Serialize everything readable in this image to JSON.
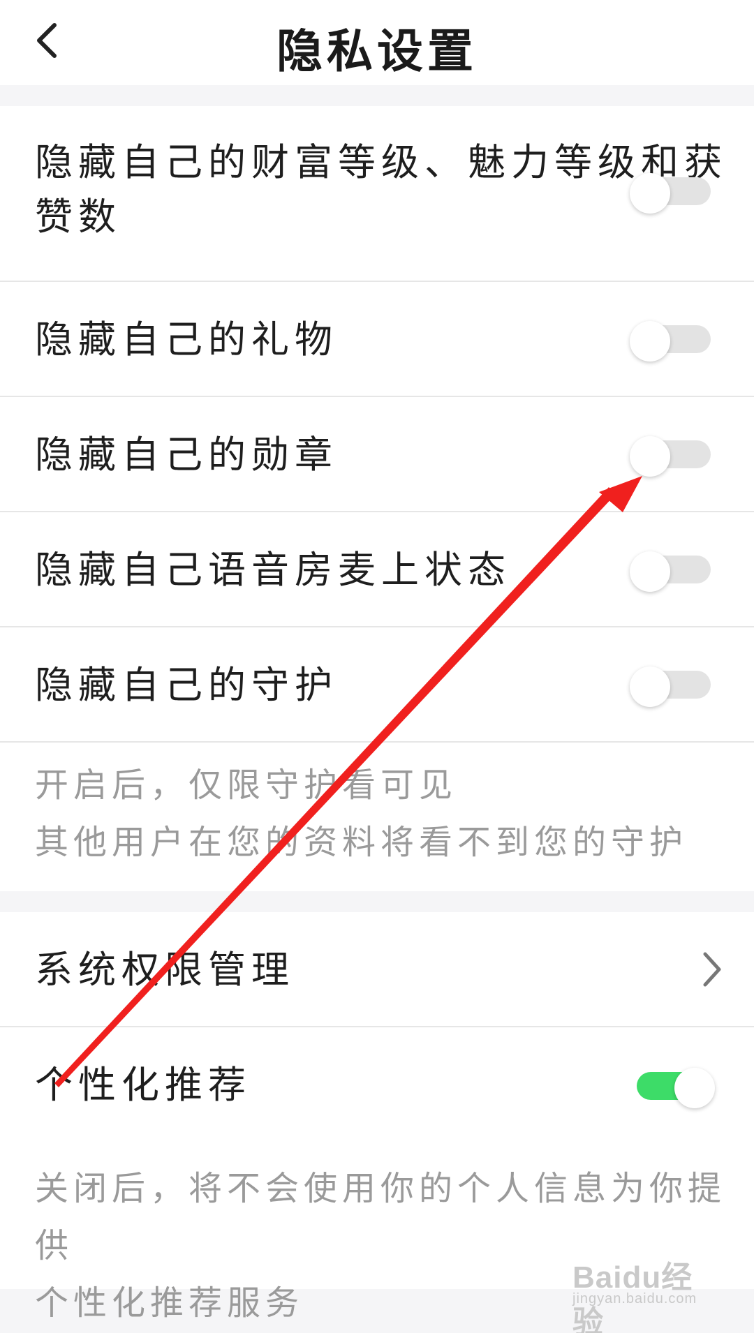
{
  "header": {
    "title": "隐私设置",
    "back_icon": "chevron-left-icon"
  },
  "section1": {
    "items": [
      {
        "label_line1": "隐藏自己的财富等级、魅力等级和获",
        "label_line2": "赞数",
        "enabled": false
      },
      {
        "label": "隐藏自己的礼物",
        "enabled": false
      },
      {
        "label": "隐藏自己的勋章",
        "enabled": false
      },
      {
        "label": "隐藏自己语音房麦上状态",
        "enabled": false
      },
      {
        "label": "隐藏自己的守护",
        "enabled": false
      }
    ],
    "note_line1": "开启后，仅限守护看可见",
    "note_line2": "其他用户在您的资料将看不到您的守护"
  },
  "section2": {
    "permissions_label": "系统权限管理",
    "permissions_icon": "chevron-right-icon",
    "recommend_label": "个性化推荐",
    "recommend_enabled": true,
    "note_line1": "关闭后，将不会使用你的个人信息为你提供",
    "note_line2": "个性化推荐服务"
  },
  "colors": {
    "toggle_on": "#3ddc68",
    "toggle_off": "#e3e3e3",
    "annotation_arrow": "#f0201e"
  },
  "watermark": {
    "logo": "Baidu经验",
    "url": "jingyan.baidu.com"
  }
}
